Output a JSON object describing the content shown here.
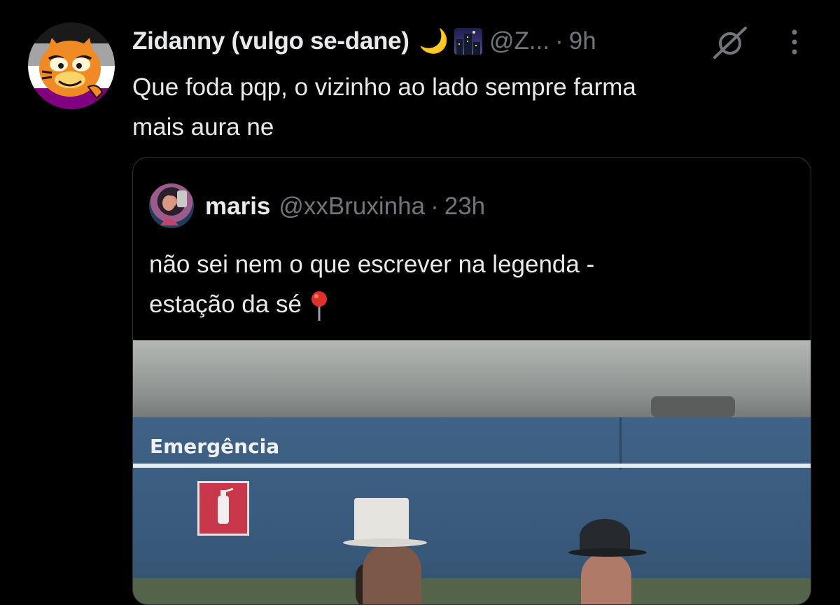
{
  "tweet": {
    "display_name": "Zidanny (vulgo se-dane)",
    "name_emoji_1": "🌙",
    "name_emoji_2": "city-night-emoji",
    "handle": "@Z...",
    "separator": "·",
    "time": "9h",
    "text_line1": "Que foda pqp, o vizinho ao lado sempre farma",
    "text_line2": "mais aura ne",
    "avatar_icon": "garfield-avatar",
    "grok_icon": "grok-icon",
    "more_icon": "more-vertical-icon"
  },
  "quote": {
    "display_name": "maris",
    "handle": "@xxBruxinha",
    "separator": "·",
    "time": "23h",
    "text_line1": "não sei nem o que escrever na legenda -",
    "text_line2": "estação da sé",
    "pin_emoji": "round-pushpin-emoji",
    "media": {
      "sign_text": "Emergência"
    }
  },
  "colors": {
    "background": "#000000",
    "primary_text": "#e7e9ea",
    "secondary_text": "#71767b",
    "border": "#2f3336",
    "pin_red": "#e0312d"
  }
}
